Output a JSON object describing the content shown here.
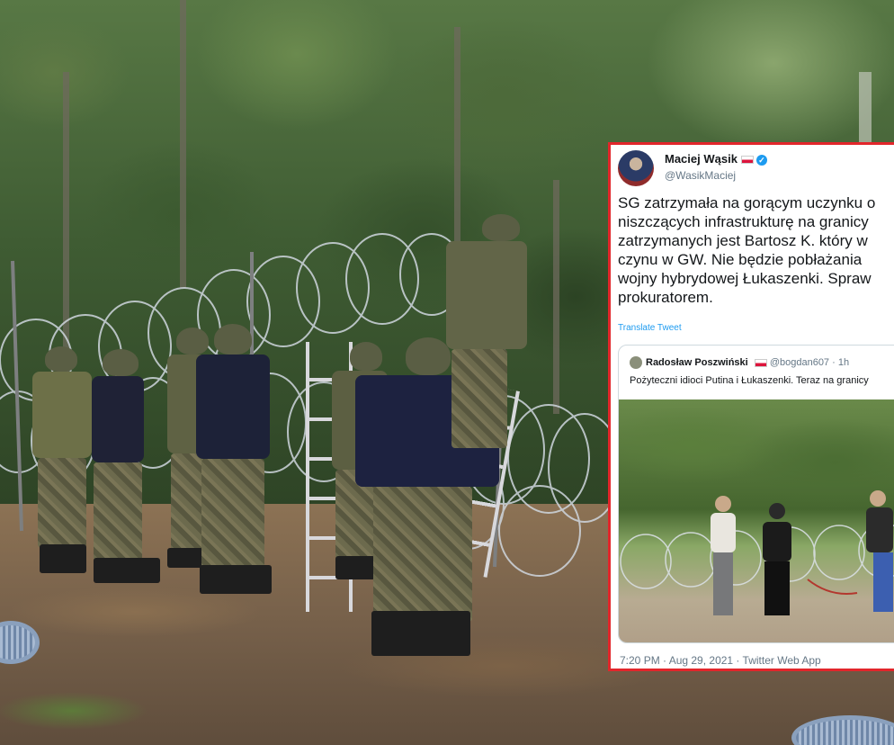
{
  "tweet": {
    "author_name": "Maciej Wąsik",
    "author_handle": "@WasikMaciej",
    "text_lines": [
      "SG zatrzymała na gorącym uczynku o",
      "niszczących infrastrukturę na granicy",
      "zatrzymanych jest Bartosz K. który w",
      "czynu w GW. Nie będzie pobłażania",
      "wojny hybrydowej Łukaszenki.  Spraw",
      "prokuratorem."
    ],
    "translate_label": "Translate Tweet",
    "quoted": {
      "author_name": "Radosław Poszwiński",
      "author_handle": "@bogdan607",
      "age": "· 1h",
      "text": "Pożyteczni idioci Putina i Łukaszenki. Teraz na granicy"
    },
    "footer": "7:20 PM · Aug 29, 2021 · Twitter Web App"
  },
  "colors": {
    "frame_red": "#e2262b",
    "link_blue": "#1d9bf0"
  },
  "icons": [
    "verified-badge-icon",
    "polish-flag-icon"
  ]
}
